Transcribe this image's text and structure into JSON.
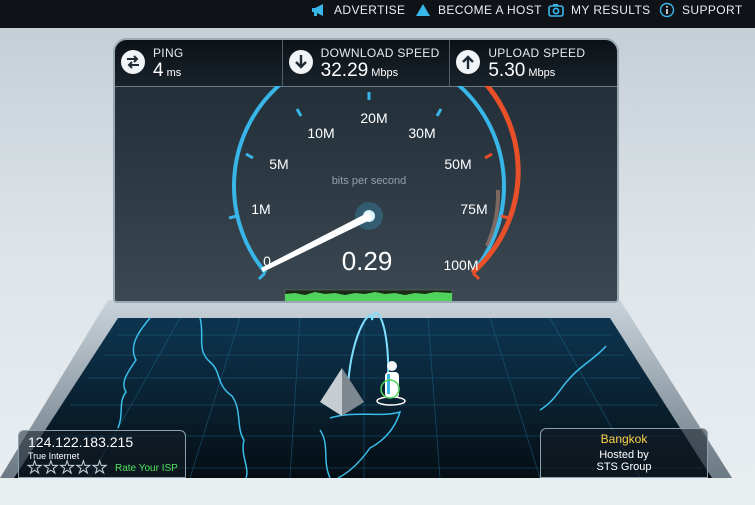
{
  "nav": {
    "advertise": "ADVERTISE",
    "become_host": "BECOME A HOST",
    "my_results": "MY RESULTS",
    "support": "SUPPORT"
  },
  "stats": {
    "ping": {
      "label": "PING",
      "value": "4",
      "unit": "ms"
    },
    "download": {
      "label": "DOWNLOAD SPEED",
      "value": "32.29",
      "unit": "Mbps"
    },
    "upload": {
      "label": "UPLOAD SPEED",
      "value": "5.30",
      "unit": "Mbps"
    }
  },
  "gauge": {
    "unit_label": "bits per second",
    "reading": "0.29",
    "ticks": [
      "0",
      "1M",
      "5M",
      "10M",
      "20M",
      "30M",
      "50M",
      "75M",
      "100M"
    ]
  },
  "client": {
    "ip": "124.122.183.215",
    "isp": "True Internet",
    "rating_stars": 5,
    "rate_label": "Rate Your ISP"
  },
  "server": {
    "city": "Bangkok",
    "hosted_by": "Hosted by",
    "host_name": "STS Group"
  },
  "colors": {
    "gauge_accent": "#38b6e8",
    "gauge_high": "#e8502a",
    "progress": "#4fd35c",
    "city": "#ffd24a",
    "rate": "#4de05a"
  }
}
